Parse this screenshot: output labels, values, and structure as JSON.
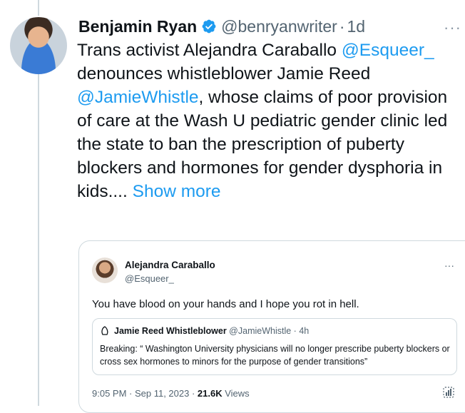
{
  "tweet": {
    "author_name": "Benjamin Ryan",
    "handle": "@benryanwriter",
    "separator": "·",
    "time": "1d",
    "more": "···",
    "text_1": "Trans activist Alejandra Caraballo ",
    "mention_1": "@Esqueer_",
    "text_2": " denounces whistleblower Jamie Reed ",
    "mention_2": "@JamieWhistle",
    "text_3": ", whose claims of poor provision of care at the Wash U pediatric gender clinic led the state to ban the prescription of puberty blockers and hormones for gender dysphoria in kids.... ",
    "show_more": "Show more"
  },
  "quote": {
    "author_name": "Alejandra Caraballo",
    "handle": "@Esqueer_",
    "more": "···",
    "text": "You have blood on your hands and I hope you rot in hell.",
    "inner": {
      "author_name": "Jamie Reed Whistleblower",
      "handle": "@JamieWhistle",
      "separator": "·",
      "time": "4h",
      "text": "Breaking: “ Washington University physicians will no longer prescribe puberty blockers or cross sex hormones to minors for the purpose of gender transitions”"
    },
    "footer": {
      "time": "9:05 PM · Sep 11, 2023 · ",
      "views_count": "21.6K",
      "views_label": " Views"
    }
  },
  "colors": {
    "accent": "#1d9bf0",
    "text": "#0f1419",
    "muted": "#536471",
    "border": "#cfd9de"
  },
  "icons": {
    "verified": "verified-badge-icon",
    "more": "more-dots-icon",
    "analytics": "analytics-icon"
  }
}
